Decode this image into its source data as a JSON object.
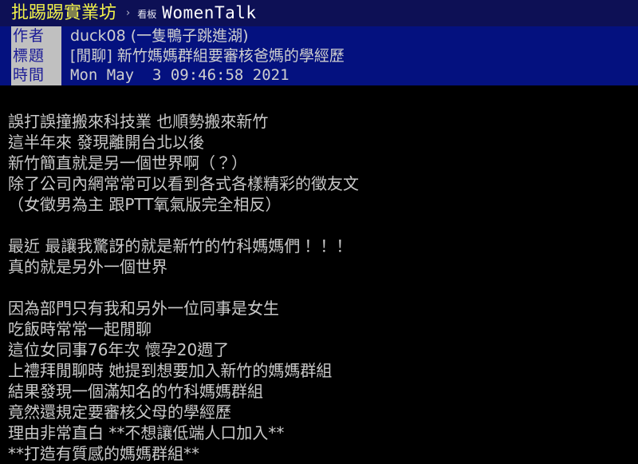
{
  "topbar": {
    "site_name": "批踢踢實業坊",
    "separator": "›",
    "board_prefix": "看板",
    "board_name": "WomenTalk",
    "site_color": "#f2f24a",
    "bar_color": "#0d1055"
  },
  "meta": {
    "header_bg": "#04117f",
    "key_bg": "#c0c0c0",
    "key_color": "#1b1b96",
    "value_color": "#cfcfcf",
    "rows": [
      {
        "key": "作者",
        "value": "duck08 (一隻鴨子跳進湖)"
      },
      {
        "key": "標題",
        "value": "[閒聊] 新竹媽媽群組要審核爸媽的學經歷"
      },
      {
        "key": "時間",
        "value": "Mon May  3 09:46:58 2021"
      }
    ]
  },
  "body": {
    "text_color": "#c9c9c9",
    "background": "#000000",
    "lines": [
      "誤打誤撞搬來科技業 也順勢搬來新竹",
      "這半年來 發現離開台北以後",
      "新竹簡直就是另一個世界啊（？）",
      "除了公司內網常常可以看到各式各樣精彩的徵友文",
      "（女徵男為主 跟PTT氧氣版完全相反）",
      "",
      "最近 最讓我驚訝的就是新竹的竹科媽媽們！！！",
      "真的就是另外一個世界",
      "",
      "因為部門只有我和另外一位同事是女生",
      "吃飯時常常一起閒聊",
      "這位女同事76年次 懷孕20週了",
      "上禮拜閒聊時 她提到想要加入新竹的媽媽群組",
      "結果發現一個滿知名的竹科媽媽群組",
      "竟然還規定要審核父母的學經歷",
      "理由非常直白 **不想讓低端人口加入**",
      "**打造有質感的媽媽群組**"
    ]
  }
}
